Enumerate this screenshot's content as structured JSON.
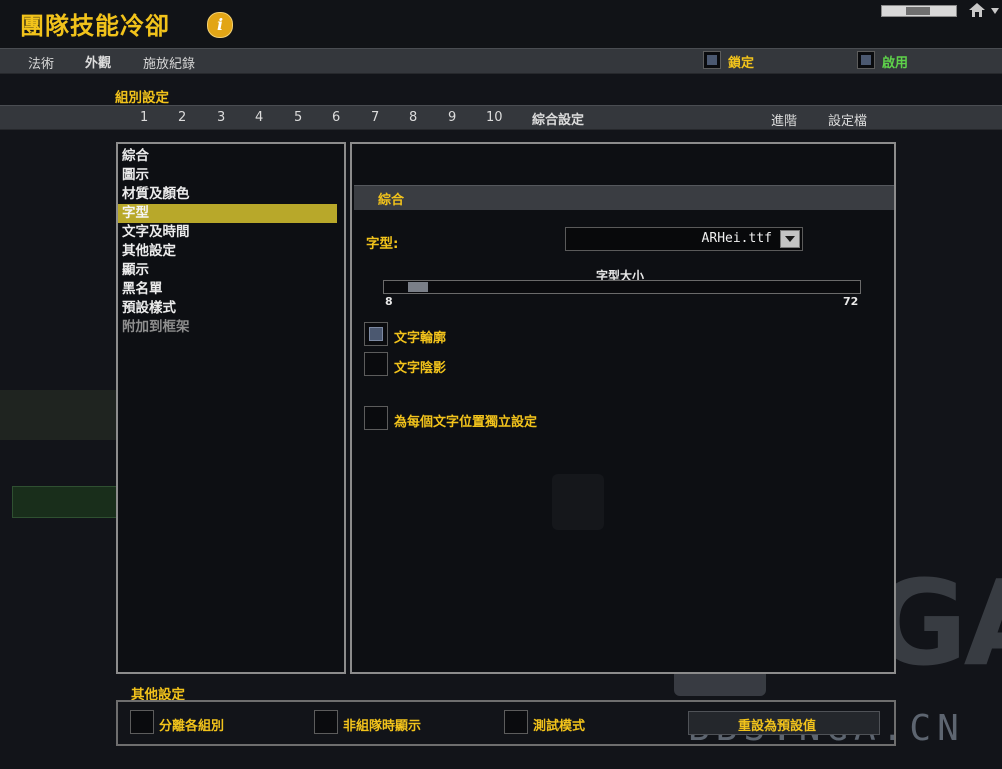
{
  "window": {
    "title": "團隊技能冷卻",
    "info_glyph": "i"
  },
  "top_tabs": [
    {
      "label": "法術",
      "active": false
    },
    {
      "label": "外觀",
      "active": true
    },
    {
      "label": "施放紀錄",
      "active": false
    }
  ],
  "top_toggles": {
    "lock_label": "鎖定",
    "lock_checked": false,
    "enable_label": "啟用",
    "enable_checked": false
  },
  "group_settings": {
    "heading": "組別設定",
    "tabs": [
      "1",
      "2",
      "3",
      "4",
      "5",
      "6",
      "7",
      "8",
      "9",
      "10"
    ],
    "general_label": "綜合設定",
    "advanced_label": "進階",
    "profile_label": "設定檔"
  },
  "nav_items": [
    {
      "label": "綜合",
      "selected": false,
      "enabled": true
    },
    {
      "label": "圖示",
      "selected": false,
      "enabled": true
    },
    {
      "label": "材質及顏色",
      "selected": false,
      "enabled": true
    },
    {
      "label": "字型",
      "selected": true,
      "enabled": true
    },
    {
      "label": "文字及時間",
      "selected": false,
      "enabled": true
    },
    {
      "label": "其他設定",
      "selected": false,
      "enabled": true
    },
    {
      "label": "顯示",
      "selected": false,
      "enabled": true
    },
    {
      "label": "黑名單",
      "selected": false,
      "enabled": true
    },
    {
      "label": "預設樣式",
      "selected": false,
      "enabled": true
    },
    {
      "label": "附加到框架",
      "selected": false,
      "enabled": false
    }
  ],
  "panel": {
    "section_title": "綜合",
    "font_label": "字型:",
    "font_value": "ARHei.ttf",
    "size_label": "字型大小",
    "size_min": "8",
    "size_max": "72",
    "size_value": 10,
    "outline_label": "文字輪廓",
    "outline_checked": true,
    "shadow_label": "文字陰影",
    "shadow_checked": false,
    "per_text_label": "為每個文字位置獨立設定",
    "per_text_checked": false
  },
  "other_settings": {
    "heading": "其他設定",
    "split_label": "分離各組別",
    "split_checked": false,
    "show_ungrouped_label": "非組隊時顯示",
    "show_ungrouped_checked": false,
    "test_label": "測試模式",
    "test_checked": false,
    "reset_label": "重設為預設值"
  },
  "watermark": {
    "brand": "NGA",
    "url": "BBS.NGA.CN"
  },
  "colors": {
    "accent_gold": "#f2c31b",
    "enable_green": "#5ed24a",
    "selected_nav": "#b8a82a"
  }
}
